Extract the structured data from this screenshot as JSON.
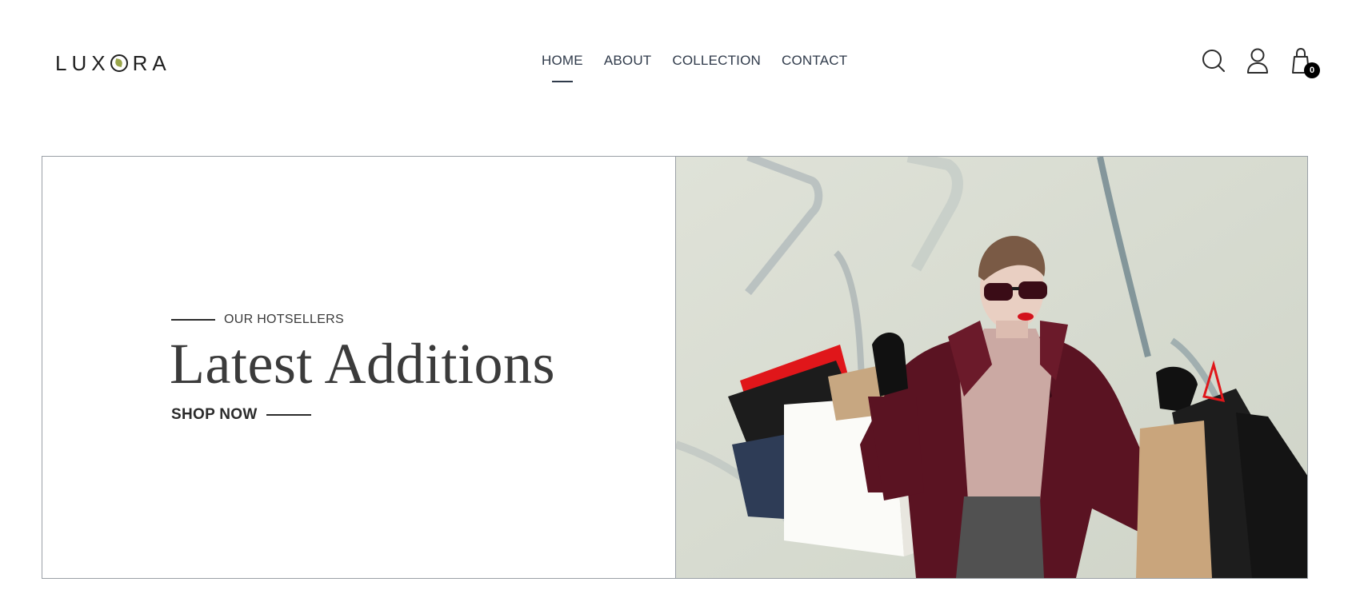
{
  "brand": {
    "logo_text_left": "LUX",
    "logo_text_right": "RA",
    "accent": "#9aa64a"
  },
  "nav": {
    "items": [
      {
        "label": "HOME",
        "active": true
      },
      {
        "label": "ABOUT",
        "active": false
      },
      {
        "label": "COLLECTION",
        "active": false
      },
      {
        "label": "CONTACT",
        "active": false
      }
    ]
  },
  "header_icons": {
    "search": "search-icon",
    "account": "user-icon",
    "cart": "shopping-bag-icon",
    "cart_count": "0"
  },
  "hero": {
    "eyebrow": "OUR HOTSELLERS",
    "headline": "Latest Additions",
    "cta": "SHOP NOW",
    "image": "woman-with-shopping-bags-photo",
    "colors": {
      "coat": "#5a1322",
      "background": "#d8dcd0",
      "bag_red": "#e0161a"
    }
  }
}
